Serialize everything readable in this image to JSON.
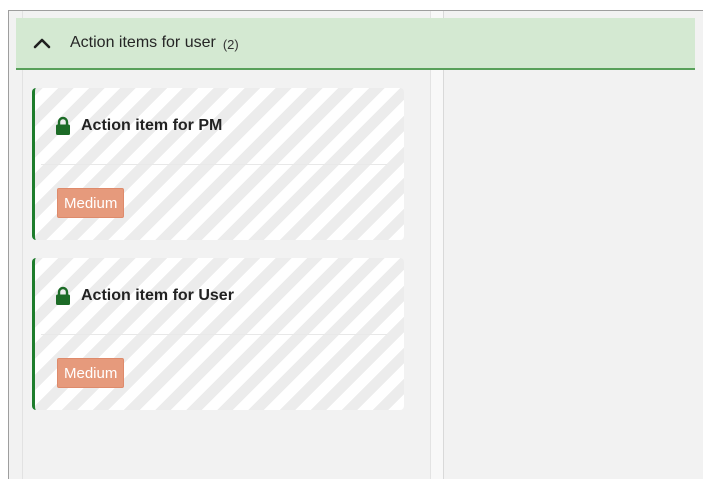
{
  "group": {
    "title": "Action items for user",
    "count": "(2)",
    "icon": "chevron-up-icon",
    "accent": "#58a05a",
    "background": "#d4e9d2"
  },
  "cards": [
    {
      "title": "Action item for PM",
      "priority": "Medium",
      "icon": "lock-icon"
    },
    {
      "title": "Action item for User",
      "priority": "Medium",
      "icon": "lock-icon"
    }
  ],
  "colors": {
    "card_accent": "#1e7d2c",
    "lock": "#1c6b26",
    "priority_medium": "#e69a7c"
  }
}
